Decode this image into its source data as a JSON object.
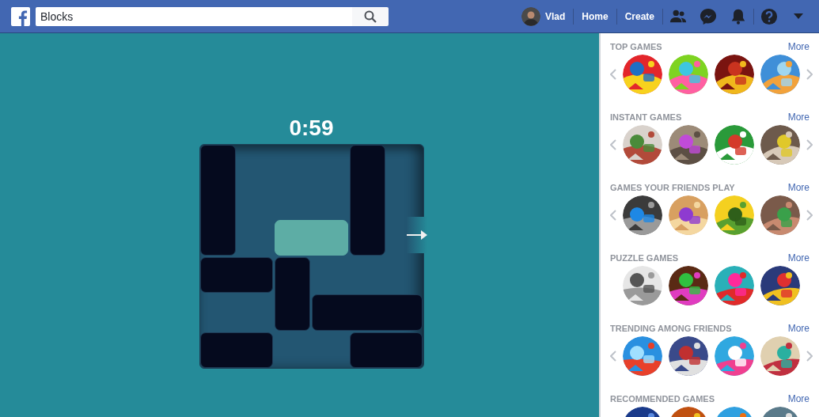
{
  "header": {
    "search": {
      "value": "Blocks"
    },
    "user": {
      "name": "Vlad"
    },
    "nav": [
      "Home",
      "Create"
    ]
  },
  "game": {
    "timer": "0:59"
  },
  "sidebar": {
    "sections": [
      {
        "title": "TOP GAMES",
        "more": "More",
        "arrows": true
      },
      {
        "title": "INSTANT GAMES",
        "more": "More",
        "arrows": true
      },
      {
        "title": "GAMES YOUR FRIENDS PLAY",
        "more": "More",
        "arrows": true
      },
      {
        "title": "PUZZLE GAMES",
        "more": "More",
        "arrows": false
      },
      {
        "title": "TRENDING AMONG FRIENDS",
        "more": "More",
        "arrows": true
      },
      {
        "title": "RECOMMENDED GAMES",
        "more": "More",
        "arrows": false
      }
    ]
  }
}
